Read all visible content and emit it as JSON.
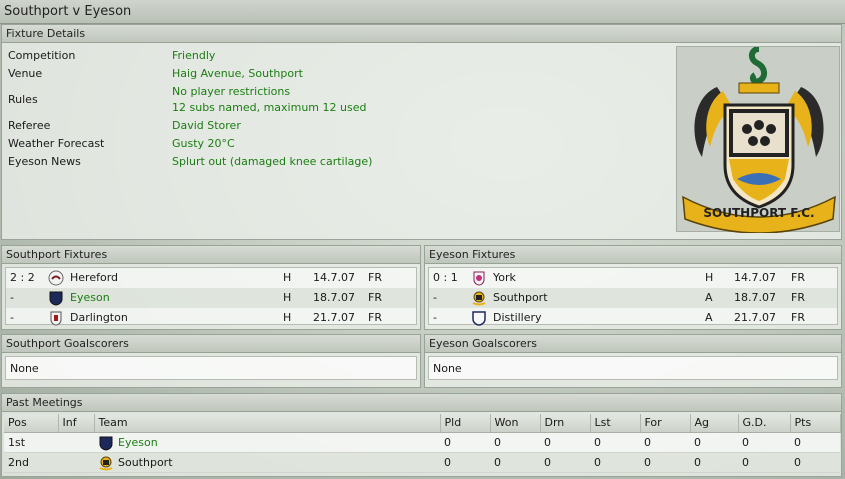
{
  "window": {
    "title": "Southport v Eyeson"
  },
  "fixture_details": {
    "header": "Fixture Details",
    "rows": [
      {
        "label": "Competition",
        "value": "Friendly"
      },
      {
        "label": "Venue",
        "value": "Haig Avenue, Southport"
      },
      {
        "label": "Rules",
        "value": "No player restrictions",
        "value2": "12 subs named, maximum 12 used"
      },
      {
        "label": "Referee",
        "value": "David Storer"
      },
      {
        "label": "Weather Forecast",
        "value": "Gusty 20°C"
      },
      {
        "label": "Eyeson News",
        "value": "Splurt out (damaged knee cartilage)"
      }
    ],
    "crest_text": "SOUTHPORT F.C."
  },
  "southport_fixtures": {
    "header": "Southport Fixtures",
    "rows": [
      {
        "score": "2 : 2",
        "team": "Hereford",
        "venue": "H",
        "date": "14.7.07",
        "comp": "FR"
      },
      {
        "score": "-",
        "team": "Eyeson",
        "venue": "H",
        "date": "18.7.07",
        "comp": "FR"
      },
      {
        "score": "-",
        "team": "Darlington",
        "venue": "H",
        "date": "21.7.07",
        "comp": "FR"
      }
    ]
  },
  "eyeson_fixtures": {
    "header": "Eyeson Fixtures",
    "rows": [
      {
        "score": "0 : 1",
        "team": "York",
        "venue": "H",
        "date": "14.7.07",
        "comp": "FR"
      },
      {
        "score": "-",
        "team": "Southport",
        "venue": "A",
        "date": "18.7.07",
        "comp": "FR"
      },
      {
        "score": "-",
        "team": "Distillery",
        "venue": "A",
        "date": "21.7.07",
        "comp": "FR"
      }
    ]
  },
  "southport_scorers": {
    "header": "Southport Goalscorers",
    "value": "None"
  },
  "eyeson_scorers": {
    "header": "Eyeson Goalscorers",
    "value": "None"
  },
  "past_meetings": {
    "header": "Past Meetings",
    "columns": [
      "Pos",
      "Inf",
      "Team",
      "Pld",
      "Won",
      "Drn",
      "Lst",
      "For",
      "Ag",
      "G.D.",
      "Pts"
    ],
    "rows": [
      {
        "pos": "1st",
        "inf": "",
        "team": "Eyeson",
        "pld": "0",
        "won": "0",
        "drn": "0",
        "lst": "0",
        "for": "0",
        "ag": "0",
        "gd": "0",
        "pts": "0"
      },
      {
        "pos": "2nd",
        "inf": "",
        "team": "Southport",
        "pld": "0",
        "won": "0",
        "drn": "0",
        "lst": "0",
        "for": "0",
        "ag": "0",
        "gd": "0",
        "pts": "0"
      }
    ]
  },
  "colors": {
    "accent_green": "#1b7d12",
    "crest_gold": "#e8b21a",
    "eyeson_navy": "#1c2a5a"
  }
}
